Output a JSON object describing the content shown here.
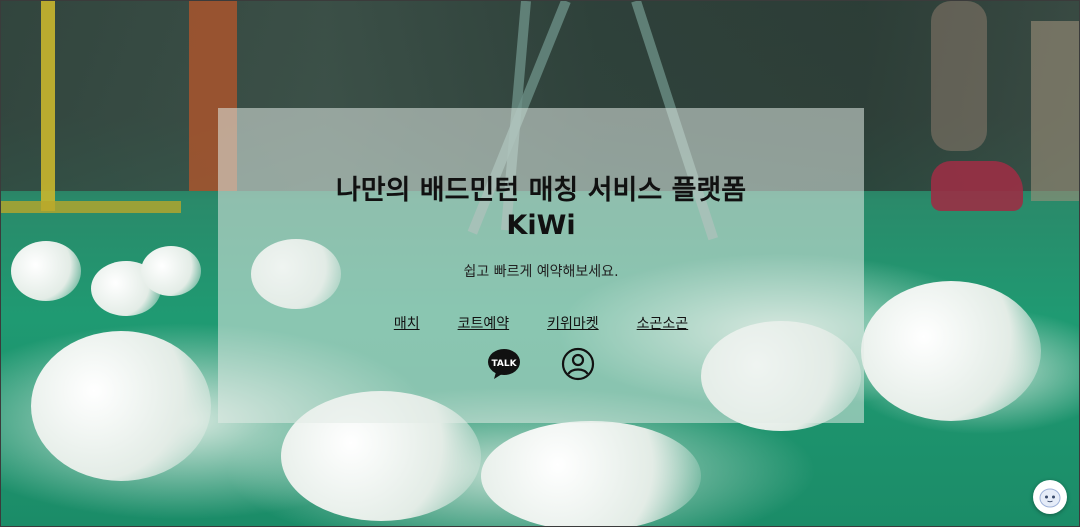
{
  "hero": {
    "title": "나만의 배드민턴 매칭 서비스 플랫폼",
    "brand": "KiWi",
    "subtitle": "쉽고 빠르게 예약해보세요."
  },
  "nav": {
    "items": [
      {
        "label": "매치"
      },
      {
        "label": "코트예약"
      },
      {
        "label": "키위마켓"
      },
      {
        "label": "소곤소곤"
      }
    ]
  },
  "icons": {
    "kakao": "kakao-talk-icon",
    "profile": "user-profile-icon",
    "chat": "chatbot-icon"
  },
  "kakao_badge_text": "TALK",
  "colors": {
    "court": "#1f9a72",
    "panel": "rgba(225,235,230,0.55)",
    "text": "#111111"
  }
}
